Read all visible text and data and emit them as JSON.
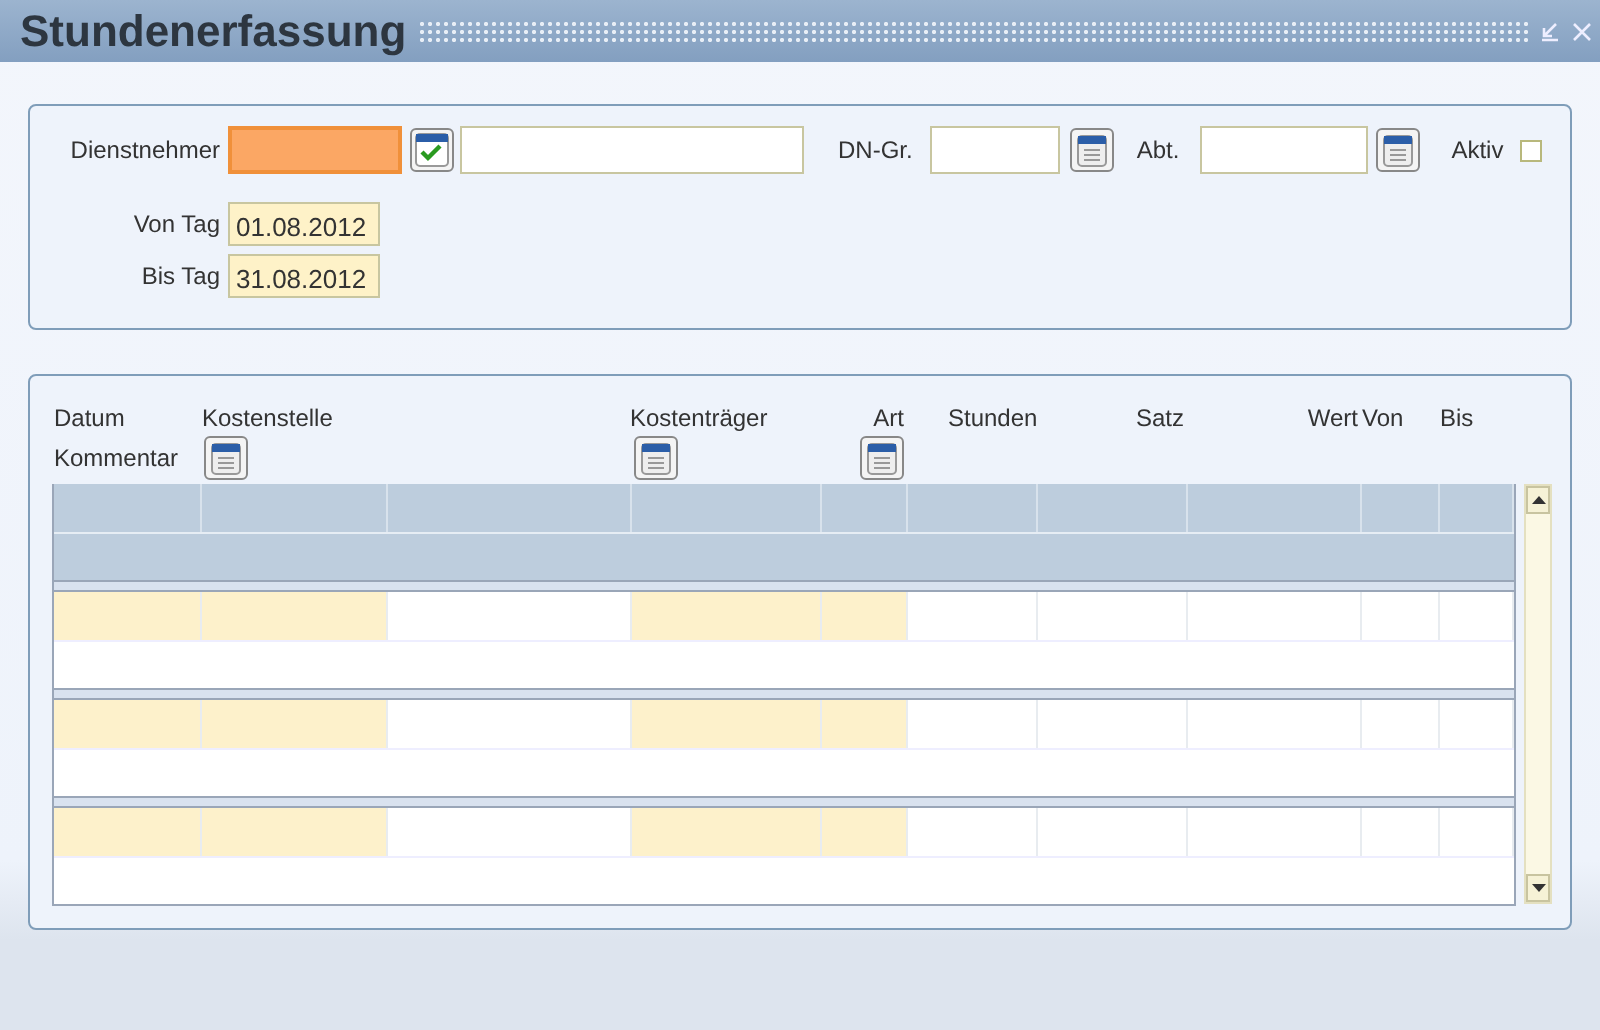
{
  "window": {
    "title": "Stundenerfassung"
  },
  "form": {
    "employee": {
      "label": "Dienstnehmer",
      "focused": true
    },
    "employee_group": {
      "label": "DN-Gr."
    },
    "department": {
      "label": "Abt."
    },
    "active": {
      "label": "Aktiv",
      "checked": false
    },
    "from_day": {
      "label": "Von Tag",
      "value": "01.08.2012"
    },
    "to_day": {
      "label": "Bis Tag",
      "value": "31.08.2012"
    }
  },
  "table": {
    "columns": [
      "Datum",
      "Kostenstelle",
      "Kostenträger",
      "Art",
      "Stunden",
      "Satz",
      "Wert",
      "Von",
      "Bis"
    ],
    "second_line": "Kommentar",
    "records": [
      {
        "cells": [
          {
            "required": true
          },
          {
            "required": true
          },
          {
            "required": false
          },
          {
            "required": true
          },
          {
            "required": true
          },
          {
            "required": false
          },
          {
            "required": false
          },
          {
            "required": false
          },
          {
            "required": false
          },
          {
            "required": false
          }
        ]
      },
      {
        "cells": [
          {
            "required": true
          },
          {
            "required": true
          },
          {
            "required": false
          },
          {
            "required": true
          },
          {
            "required": true
          },
          {
            "required": false
          },
          {
            "required": false
          },
          {
            "required": false
          },
          {
            "required": false
          },
          {
            "required": false
          }
        ]
      },
      {
        "cells": [
          {
            "required": true
          },
          {
            "required": true
          },
          {
            "required": false
          },
          {
            "required": true
          },
          {
            "required": true
          },
          {
            "required": false
          },
          {
            "required": false
          },
          {
            "required": false
          },
          {
            "required": false
          },
          {
            "required": false
          }
        ]
      }
    ]
  }
}
